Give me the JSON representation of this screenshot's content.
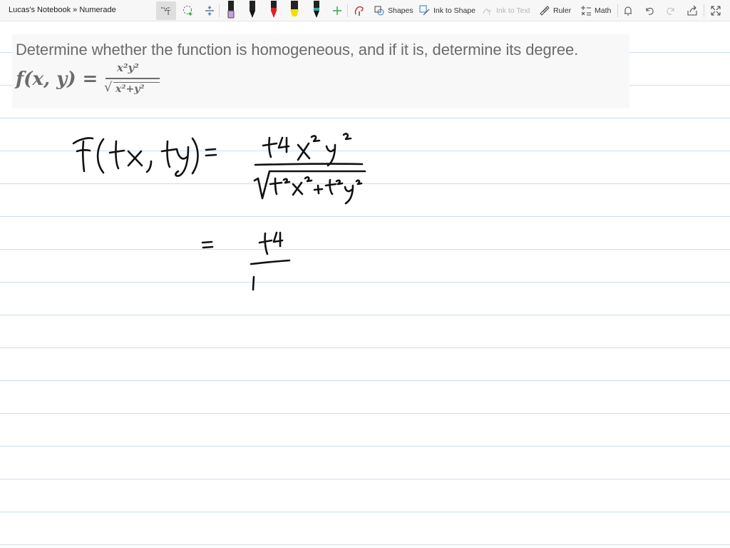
{
  "breadcrumb": "Lucas's Notebook » Numerade",
  "toolbar": {
    "shapes_label": "Shapes",
    "ink_to_shape_label": "Ink to Shape",
    "ink_to_text_label": "Ink to Text",
    "ruler_label": "Ruler",
    "math_label": "Math",
    "pen_colors": [
      "#c8a0e0",
      "#111111",
      "#e02020",
      "#f0e000",
      "#000000"
    ],
    "accent_color": "#3aa14a"
  },
  "question": {
    "text": "Determine whether the function is homogeneous, and if it is, determine its degree.",
    "lhs": "f(x, y) =",
    "numerator": "x²y²",
    "denominator": "x²+y²"
  }
}
